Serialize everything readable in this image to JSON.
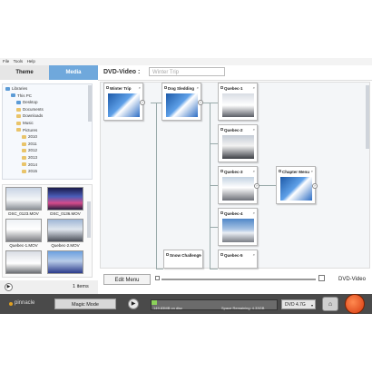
{
  "menu": [
    "File",
    "Tools",
    "Help"
  ],
  "tabs": {
    "theme": "Theme",
    "media": "Media"
  },
  "header": {
    "label": "DVD-Video :",
    "title_placeholder": "Winter Trip"
  },
  "folder_tree": [
    {
      "label": "Libraries",
      "indent": 0,
      "blue": true
    },
    {
      "label": "This PC",
      "indent": 1,
      "blue": true
    },
    {
      "label": "Desktop",
      "indent": 2,
      "blue": true
    },
    {
      "label": "Documents",
      "indent": 2
    },
    {
      "label": "Downloads",
      "indent": 2
    },
    {
      "label": "Music",
      "indent": 2
    },
    {
      "label": "Pictures",
      "indent": 2
    },
    {
      "label": "2010",
      "indent": 3
    },
    {
      "label": "2011",
      "indent": 3
    },
    {
      "label": "2012",
      "indent": 3
    },
    {
      "label": "2013",
      "indent": 3
    },
    {
      "label": "2014",
      "indent": 3
    },
    {
      "label": "2015",
      "indent": 3
    }
  ],
  "media_files": [
    "DSC_0123.MOV",
    "DSC_0136.MOV",
    "Quebec-1.MOV",
    "Quebec-2.MOV"
  ],
  "items_count": "1 items",
  "nodes": [
    "Winter Trip",
    "Dog Sledding",
    "Quebec-1",
    "Quebec-2",
    "Quebec-3",
    "Chapter Menu",
    "Quebec-4",
    "Snow Challenge",
    "Quebec-5"
  ],
  "edit_menu": "Edit Menu",
  "output_format": "DVD-Video",
  "statusbar": {
    "logo": "pinnacle",
    "magic_mode": "Magic Mode",
    "disc_used": "149.83MB on disc",
    "disc_remaining": "Space Remaining: 4.33GB",
    "disc_used_fraction": 0.04,
    "disc_type": "DVD 4.7G"
  },
  "colors": {
    "media_tab": "#6fa8dc",
    "burn": "#e2531e",
    "disc_fill": "#8bd15a",
    "statusbar": "#4a4a4a"
  }
}
